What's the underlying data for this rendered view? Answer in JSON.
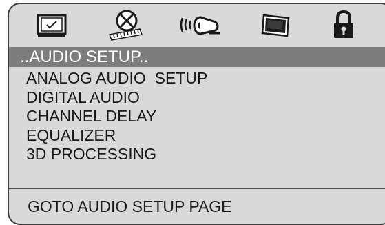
{
  "icon_bar": {
    "tabs": [
      {
        "name": "tv-display-icon",
        "selected": false
      },
      {
        "name": "film-reel-icon",
        "selected": false
      },
      {
        "name": "speaker-audio-icon",
        "selected": true
      },
      {
        "name": "picture-video-icon",
        "selected": false
      },
      {
        "name": "padlock-icon",
        "selected": false
      }
    ]
  },
  "title_bar": {
    "label": "..AUDIO SETUP.."
  },
  "menu": {
    "items": [
      {
        "label": "ANALOG AUDIO  SETUP"
      },
      {
        "label": "DIGITAL AUDIO"
      },
      {
        "label": "CHANNEL DELAY"
      },
      {
        "label": "EQUALIZER"
      },
      {
        "label": "3D PROCESSING"
      }
    ]
  },
  "status": {
    "text": "GOTO AUDIO SETUP PAGE"
  },
  "colors": {
    "panel_background": "#d9d9d9",
    "title_bar_background": "#7d7d7d",
    "title_text": "#ffffff",
    "menu_text": "#1a1a1a",
    "border": "#3c3c3c"
  }
}
